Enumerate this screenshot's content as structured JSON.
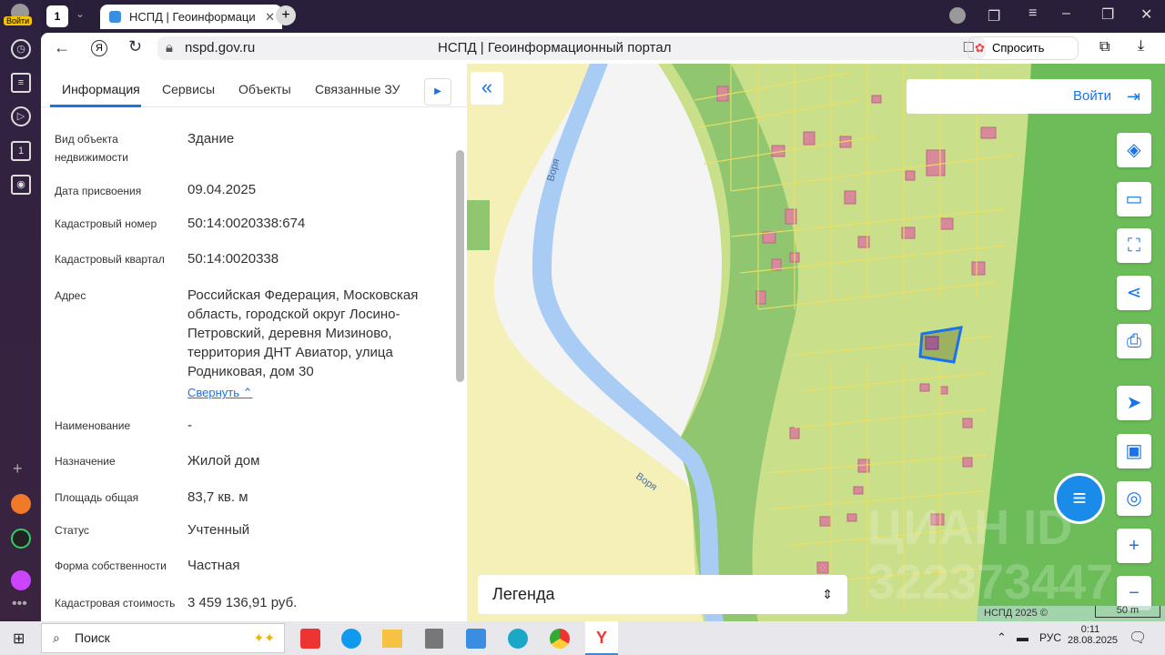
{
  "browser": {
    "login_badge": "Войти",
    "tab_count": "1",
    "tab_title": "НСПД | Геоинформаци",
    "url": "nspd.gov.ru",
    "page_title": "НСПД | Геоинформационный портал",
    "ask_button": "Спросить"
  },
  "panel": {
    "tabs": [
      "Информация",
      "Сервисы",
      "Объекты",
      "Связанные ЗУ"
    ],
    "fields": [
      {
        "label": "Вид объекта недвижимости",
        "value": "Здание"
      },
      {
        "label": "Дата присвоения",
        "value": "09.04.2025"
      },
      {
        "label": "Кадастровый номер",
        "value": "50:14:0020338:674"
      },
      {
        "label": "Кадастровый квартал",
        "value": "50:14:0020338"
      },
      {
        "label": "Адрес",
        "value": "Российская Федерация, Московская область, городской округ Лосино-Петровский, деревня Мизиново, территория ДНТ Авиатор, улица Родниковая, дом 30"
      },
      {
        "label": "Наименование",
        "value": "-"
      },
      {
        "label": "Назначение",
        "value": "Жилой дом"
      },
      {
        "label": "Площадь общая",
        "value": "83,7 кв. м"
      },
      {
        "label": "Статус",
        "value": "Учтенный"
      },
      {
        "label": "Форма собственности",
        "value": "Частная"
      },
      {
        "label": "Кадастровая стоимость",
        "value": "3 459 136,91 руб."
      }
    ],
    "collapse_link": "Свернуть"
  },
  "map": {
    "login_button": "Войти",
    "river_label": "Воря",
    "legend_label": "Легенда",
    "copyright": "НСПД 2025 ©",
    "scale": "50 m",
    "watermark": "ЦИАН ID 322373447",
    "accent": "#1a73e8"
  },
  "taskbar": {
    "search_placeholder": "Поиск",
    "lang": "РУС",
    "time": "0:11",
    "date": "28.08.2025"
  }
}
